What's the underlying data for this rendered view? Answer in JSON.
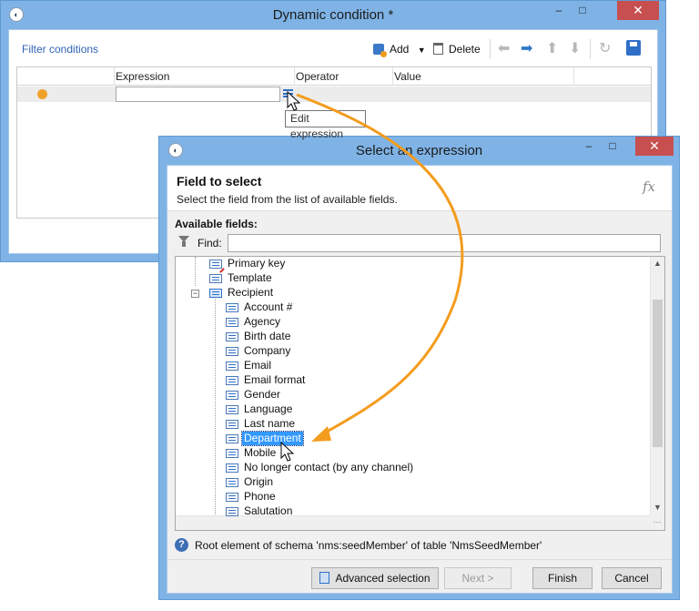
{
  "main_window": {
    "title": "Dynamic condition *",
    "app_icon": "app-logo-icon",
    "controls": {
      "minimize": "–",
      "maximize": "□",
      "close": "✕"
    },
    "toolbar": {
      "filter_link": "Filter conditions",
      "add_label": "Add",
      "delete_label": "Delete"
    },
    "grid": {
      "columns": [
        "Expression",
        "Operator",
        "Value"
      ],
      "row_expression_value": ""
    },
    "tooltip": "Edit expression"
  },
  "dialog": {
    "title": "Select an expression",
    "controls": {
      "minimize": "–",
      "maximize": "□",
      "close": "✕"
    },
    "header_title": "Field to select",
    "header_subtitle": "Select the field from the list of available fields.",
    "fx_label": "fx",
    "available_label": "Available fields:",
    "find_label": "Find:",
    "find_value": "",
    "tree": {
      "top_nodes": [
        "Primary key",
        "Template",
        "Recipient"
      ],
      "recipient_children": [
        "Account #",
        "Agency",
        "Birth date",
        "Company",
        "Email",
        "Email format",
        "Gender",
        "Language",
        "Last name",
        "Department",
        "Mobile",
        "No longer contact (by any channel)",
        "Origin",
        "Phone",
        "Salutation"
      ],
      "selected": "Department"
    },
    "info_text": "Root element of schema 'nms:seedMember' of table 'NmsSeedMember'",
    "buttons": {
      "advanced": "Advanced selection",
      "next": "Next >",
      "finish": "Finish",
      "cancel": "Cancel"
    }
  },
  "colors": {
    "accent_blue": "#2f63b5",
    "arrow_orange": "#f39c1e",
    "selection": "#3399ff",
    "close_red": "#c74f4f"
  }
}
